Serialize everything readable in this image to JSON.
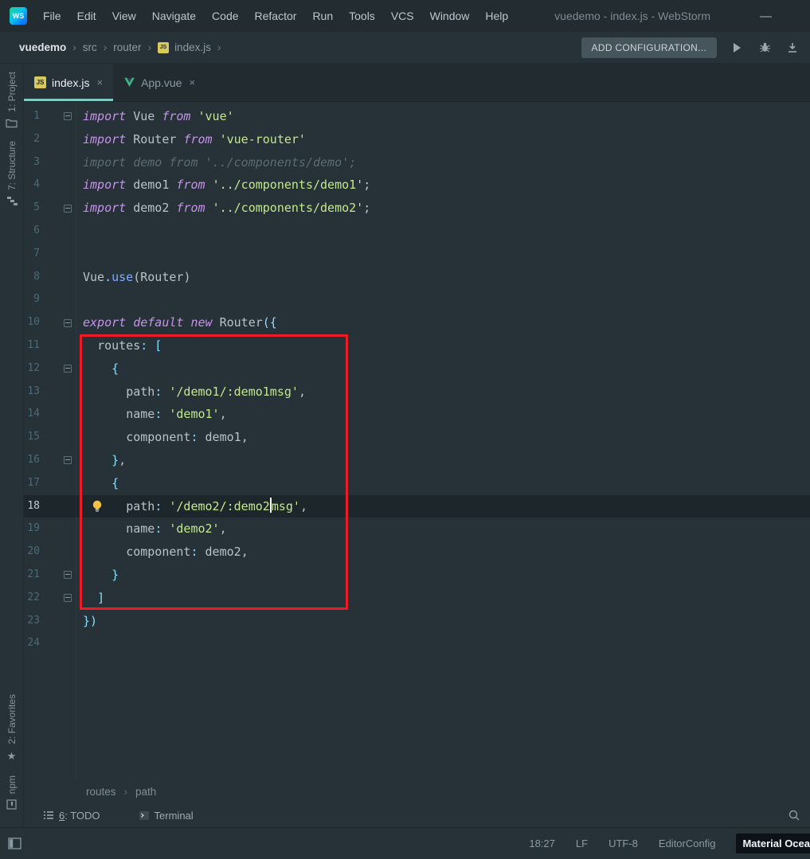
{
  "window": {
    "title": "vuedemo - index.js - WebStorm",
    "minimize_glyph": "—",
    "logo_text": "WS"
  },
  "menu": {
    "items": [
      "File",
      "Edit",
      "View",
      "Navigate",
      "Code",
      "Refactor",
      "Run",
      "Tools",
      "VCS",
      "Window",
      "Help"
    ]
  },
  "breadcrumb_bar": {
    "items": [
      "vuedemo",
      "src",
      "router",
      "index.js"
    ],
    "separator": "›",
    "add_configuration_label": "ADD CONFIGURATION...",
    "file_icon_text": "JS"
  },
  "tabs": [
    {
      "label": "index.js",
      "close_glyph": "×",
      "icon_text": "JS"
    },
    {
      "label": "App.vue",
      "close_glyph": "×"
    }
  ],
  "tool_windows": {
    "project": "1: Project",
    "structure": "7: Structure",
    "favorites": "2: Favorites",
    "npm": "npm",
    "star_glyph": "★"
  },
  "editor": {
    "lines": [
      {
        "num": 1,
        "fold": true,
        "tokens": [
          {
            "t": "import ",
            "c": "kw"
          },
          {
            "t": "Vue ",
            "c": "id"
          },
          {
            "t": "from ",
            "c": "kw"
          },
          {
            "t": "'vue'",
            "c": "str"
          }
        ]
      },
      {
        "num": 2,
        "tokens": [
          {
            "t": "import ",
            "c": "kw"
          },
          {
            "t": "Router ",
            "c": "id"
          },
          {
            "t": "from ",
            "c": "kw"
          },
          {
            "t": "'vue-router'",
            "c": "str"
          }
        ]
      },
      {
        "num": 3,
        "tokens": [
          {
            "t": "import demo from '../components/demo';",
            "c": "cmt"
          }
        ]
      },
      {
        "num": 4,
        "tokens": [
          {
            "t": "import ",
            "c": "kw"
          },
          {
            "t": "demo1 ",
            "c": "id"
          },
          {
            "t": "from ",
            "c": "kw"
          },
          {
            "t": "'../components/demo1'",
            "c": "str"
          },
          {
            "t": ";",
            "c": "id"
          }
        ]
      },
      {
        "num": 5,
        "fold": true,
        "tokens": [
          {
            "t": "import ",
            "c": "kw"
          },
          {
            "t": "demo2 ",
            "c": "id"
          },
          {
            "t": "from ",
            "c": "kw"
          },
          {
            "t": "'../components/demo2'",
            "c": "str"
          },
          {
            "t": ";",
            "c": "id"
          }
        ]
      },
      {
        "num": 6,
        "tokens": []
      },
      {
        "num": 7,
        "tokens": []
      },
      {
        "num": 8,
        "tokens": [
          {
            "t": "Vue",
            "c": "id"
          },
          {
            "t": ".",
            "c": "punc"
          },
          {
            "t": "use",
            "c": "fn"
          },
          {
            "t": "(",
            "c": "id"
          },
          {
            "t": "Router",
            "c": "id"
          },
          {
            "t": ")",
            "c": "id"
          }
        ]
      },
      {
        "num": 9,
        "tokens": []
      },
      {
        "num": 10,
        "fold": true,
        "tokens": [
          {
            "t": "export ",
            "c": "kw"
          },
          {
            "t": "default ",
            "c": "kw"
          },
          {
            "t": "new ",
            "c": "kw"
          },
          {
            "t": "Router",
            "c": "id"
          },
          {
            "t": "({",
            "c": "punc"
          }
        ]
      },
      {
        "num": 11,
        "indent": 2,
        "tokens": [
          {
            "t": "routes",
            "c": "id"
          },
          {
            "t": ": [",
            "c": "punc"
          }
        ]
      },
      {
        "num": 12,
        "indent": 4,
        "fold": true,
        "tokens": [
          {
            "t": "{",
            "c": "punc"
          }
        ]
      },
      {
        "num": 13,
        "indent": 6,
        "tokens": [
          {
            "t": "path",
            "c": "id"
          },
          {
            "t": ": ",
            "c": "punc"
          },
          {
            "t": "'/demo1/:demo1msg'",
            "c": "str"
          },
          {
            "t": ",",
            "c": "id"
          }
        ]
      },
      {
        "num": 14,
        "indent": 6,
        "tokens": [
          {
            "t": "name",
            "c": "id"
          },
          {
            "t": ": ",
            "c": "punc"
          },
          {
            "t": "'demo1'",
            "c": "str"
          },
          {
            "t": ",",
            "c": "id"
          }
        ]
      },
      {
        "num": 15,
        "indent": 6,
        "tokens": [
          {
            "t": "component",
            "c": "id"
          },
          {
            "t": ": ",
            "c": "punc"
          },
          {
            "t": "demo1",
            "c": "id"
          },
          {
            "t": ",",
            "c": "id"
          }
        ]
      },
      {
        "num": 16,
        "indent": 4,
        "fold": true,
        "tokens": [
          {
            "t": "}",
            "c": "punc"
          },
          {
            "t": ",",
            "c": "id"
          }
        ]
      },
      {
        "num": 17,
        "indent": 4,
        "tokens": [
          {
            "t": "{",
            "c": "punc"
          }
        ]
      },
      {
        "num": 18,
        "indent": 6,
        "current": true,
        "bulb": true,
        "tokens": [
          {
            "t": "path",
            "c": "id"
          },
          {
            "t": ": ",
            "c": "punc"
          },
          {
            "t": "'/demo2/:demo2",
            "c": "str"
          },
          {
            "cursor": true
          },
          {
            "t": "msg'",
            "c": "str"
          },
          {
            "t": ",",
            "c": "id"
          }
        ]
      },
      {
        "num": 19,
        "indent": 6,
        "tokens": [
          {
            "t": "name",
            "c": "id"
          },
          {
            "t": ": ",
            "c": "punc"
          },
          {
            "t": "'demo2'",
            "c": "str"
          },
          {
            "t": ",",
            "c": "id"
          }
        ]
      },
      {
        "num": 20,
        "indent": 6,
        "tokens": [
          {
            "t": "component",
            "c": "id"
          },
          {
            "t": ": ",
            "c": "punc"
          },
          {
            "t": "demo2",
            "c": "id"
          },
          {
            "t": ",",
            "c": "id"
          }
        ]
      },
      {
        "num": 21,
        "indent": 4,
        "fold": true,
        "tokens": [
          {
            "t": "}",
            "c": "punc"
          }
        ]
      },
      {
        "num": 22,
        "indent": 2,
        "fold": true,
        "tokens": [
          {
            "t": "]",
            "c": "punc"
          }
        ]
      },
      {
        "num": 23,
        "tokens": [
          {
            "t": "})",
            "c": "punc"
          }
        ]
      },
      {
        "num": 24,
        "tokens": []
      }
    ]
  },
  "editor_breadcrumbs": {
    "items": [
      "routes",
      "path"
    ],
    "separator": "›"
  },
  "bottom_bar": {
    "todo_mnemonic": "6",
    "todo_label": ": TODO",
    "terminal_label": "Terminal"
  },
  "status_bar": {
    "caret_position": "18:27",
    "line_separator": "LF",
    "encoding": "UTF-8",
    "editorconfig": "EditorConfig",
    "theme": "Material Ocea"
  },
  "colors": {
    "accent_teal": "#80cbc4",
    "annotation_red": "#ed1c24",
    "keyword": "#c792ea",
    "string": "#c3e88d",
    "comment": "#5b6b73",
    "function_call": "#82aaff",
    "punctuation": "#89ddff"
  }
}
